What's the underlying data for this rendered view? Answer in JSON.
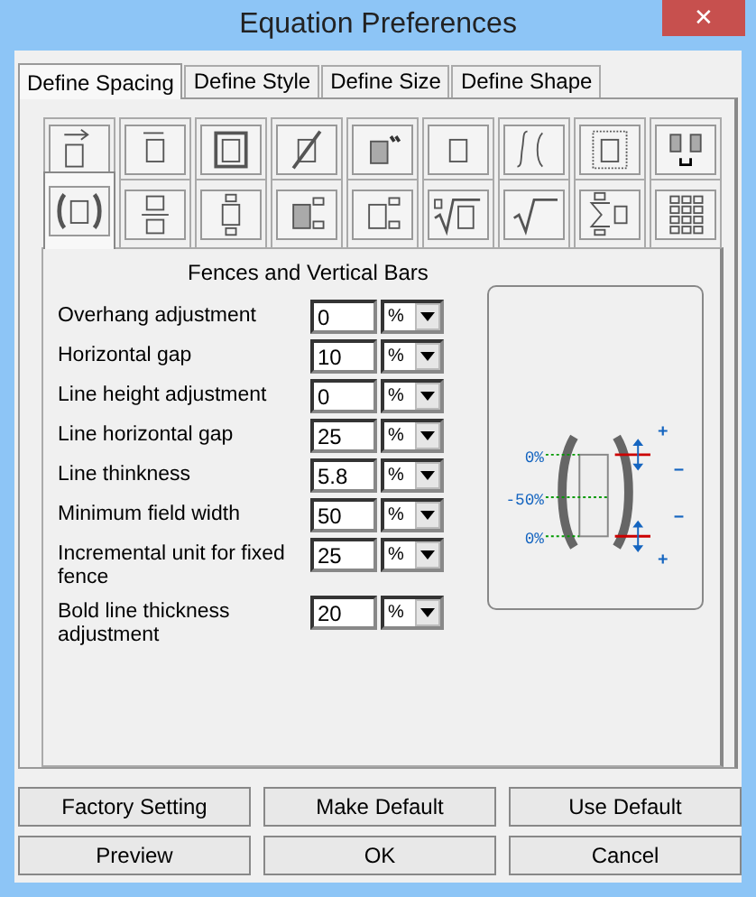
{
  "window": {
    "title": "Equation Preferences",
    "close": "✕"
  },
  "tabs": [
    {
      "label": "Define Spacing",
      "selected": true
    },
    {
      "label": "Define Style",
      "selected": false
    },
    {
      "label": "Define Size",
      "selected": false
    },
    {
      "label": "Define Shape",
      "selected": false
    }
  ],
  "symbol_tabs": [
    {
      "kind": "arrow",
      "selected": false
    },
    {
      "kind": "overbar",
      "selected": false
    },
    {
      "kind": "framed",
      "selected": false
    },
    {
      "kind": "slash",
      "selected": false
    },
    {
      "kind": "prime",
      "selected": false
    },
    {
      "kind": "plain",
      "selected": false
    },
    {
      "kind": "integral",
      "selected": false
    },
    {
      "kind": "dotted",
      "selected": false
    },
    {
      "kind": "underbracket",
      "selected": false
    },
    {
      "kind": "fence",
      "selected": true
    },
    {
      "kind": "fraction",
      "selected": false
    },
    {
      "kind": "stack",
      "selected": false
    },
    {
      "kind": "shaded-scripts",
      "selected": false
    },
    {
      "kind": "scripts",
      "selected": false
    },
    {
      "kind": "nth-root",
      "selected": false
    },
    {
      "kind": "sqrt",
      "selected": false
    },
    {
      "kind": "sum",
      "selected": false
    },
    {
      "kind": "matrix",
      "selected": false
    }
  ],
  "section_title": "Fences and Vertical Bars",
  "fields": [
    {
      "label": "Overhang adjustment",
      "value": "0",
      "unit": "%"
    },
    {
      "label": "Horizontal gap",
      "value": "10",
      "unit": "%"
    },
    {
      "label": "Line height adjustment",
      "value": "0",
      "unit": "%"
    },
    {
      "label": "Line horizontal gap",
      "value": "25",
      "unit": "%"
    },
    {
      "label": "Line thinkness",
      "value": "5.8",
      "unit": "%"
    },
    {
      "label": "Minimum field width",
      "value": "50",
      "unit": "%"
    },
    {
      "label": "Incremental unit for fixed fence",
      "value": "25",
      "unit": "%"
    },
    {
      "label": "Bold line thickness adjustment",
      "value": "20",
      "unit": "%"
    }
  ],
  "diagram": {
    "labels": [
      "0%",
      "-50%",
      "0%"
    ],
    "signs": [
      "+",
      "−",
      "−",
      "+"
    ]
  },
  "buttons": [
    [
      "Factory Setting",
      "Make Default",
      "Use Default"
    ],
    [
      "Preview",
      "OK",
      "Cancel"
    ]
  ]
}
